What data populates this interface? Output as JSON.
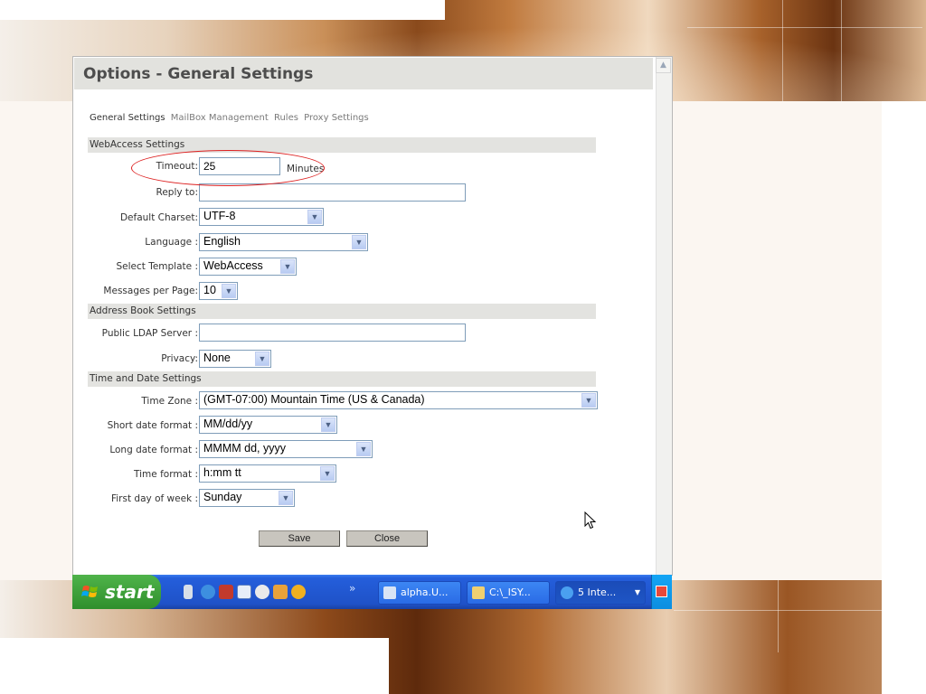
{
  "window": {
    "title": "Options - General Settings",
    "scroll_up_glyph": "▲"
  },
  "tabs": [
    {
      "label": "General Settings"
    },
    {
      "label": "MailBox Management"
    },
    {
      "label": "Rules"
    },
    {
      "label": "Proxy Settings"
    }
  ],
  "sections": {
    "webaccess": "WebAccess Settings",
    "addressbook": "Address Book Settings",
    "timedate": "Time and Date Settings"
  },
  "fields": {
    "timeout": {
      "label": "Timeout:",
      "value": "25",
      "unit": "Minutes"
    },
    "reply_to": {
      "label": "Reply to:",
      "value": ""
    },
    "charset": {
      "label": "Default Charset:",
      "value": "UTF-8"
    },
    "language": {
      "label": "Language :",
      "value": "English"
    },
    "template": {
      "label": "Select Template :",
      "value": "WebAccess"
    },
    "messages_per_page": {
      "label": "Messages per Page:",
      "value": "10"
    },
    "ldap": {
      "label": "Public LDAP Server :",
      "value": ""
    },
    "privacy": {
      "label": "Privacy:",
      "value": "None"
    },
    "timezone": {
      "label": "Time Zone :",
      "value": "(GMT-07:00) Mountain Time (US & Canada)"
    },
    "short_date": {
      "label": "Short date format :",
      "value": "MM/dd/yy"
    },
    "long_date": {
      "label": "Long date format :",
      "value": "MMMM dd, yyyy"
    },
    "time_format": {
      "label": "Time format :",
      "value": "h:mm tt"
    },
    "first_day": {
      "label": "First day of week :",
      "value": "Sunday"
    }
  },
  "buttons": {
    "save": "Save",
    "close": "Close"
  },
  "taskbar": {
    "start": "start",
    "overflow": "»",
    "tasks": [
      {
        "label": "alpha.U..."
      },
      {
        "label": "C:\\_ISY..."
      },
      {
        "label": "5 Inte..."
      }
    ]
  },
  "colors": {
    "highlight": "#dd2222",
    "taskbar": "#245edb",
    "start_button": "#3a9a35"
  }
}
